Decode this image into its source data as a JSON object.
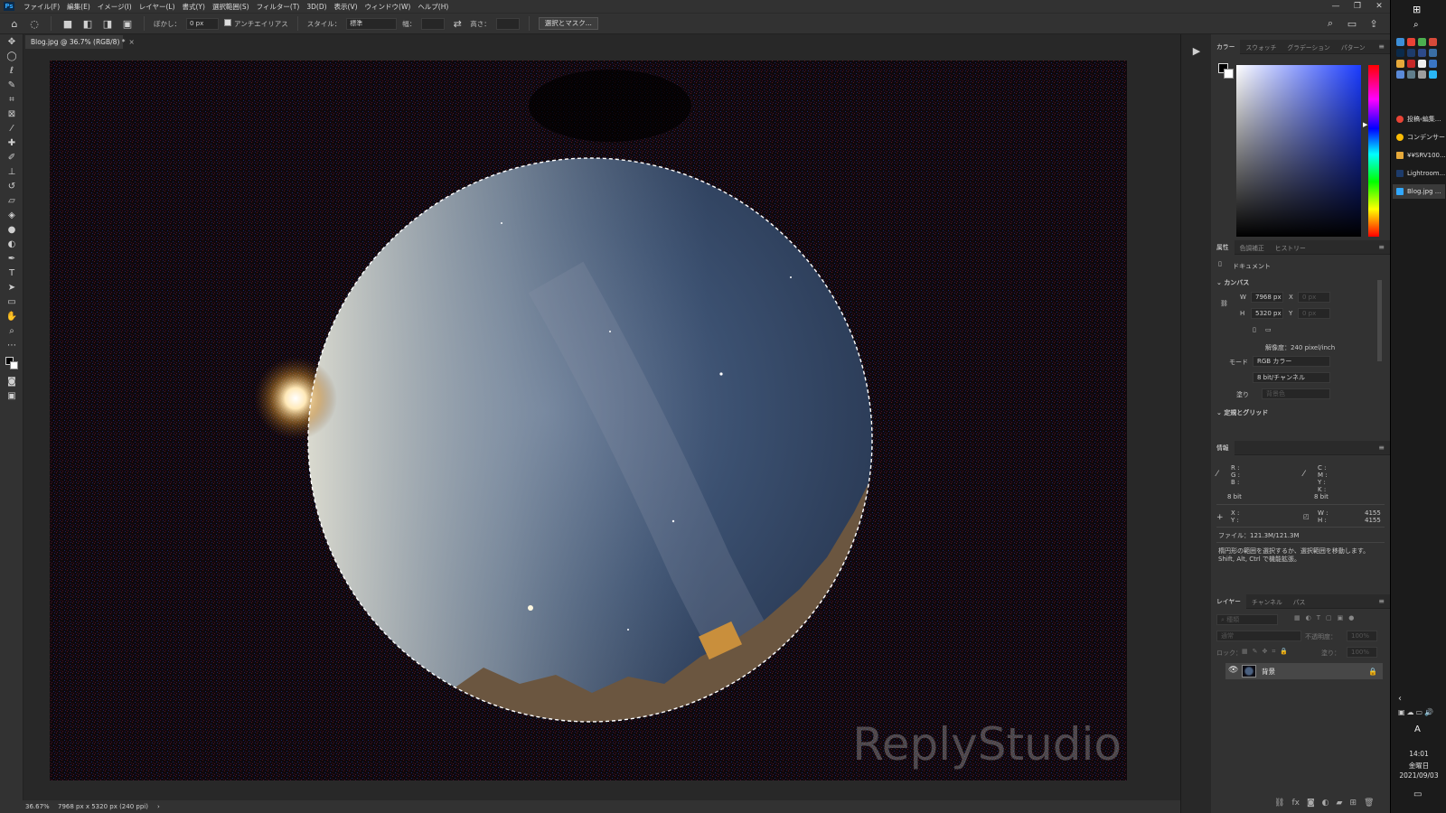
{
  "app": {
    "logo": "Ps"
  },
  "menu": [
    "ファイル(F)",
    "編集(E)",
    "イメージ(I)",
    "レイヤー(L)",
    "書式(Y)",
    "選択範囲(S)",
    "フィルター(T)",
    "3D(D)",
    "表示(V)",
    "ウィンドウ(W)",
    "ヘルプ(H)"
  ],
  "options": {
    "feather_label": "ぼかし：",
    "feather_value": "0 px",
    "antialias_label": "アンチエイリアス",
    "style_label": "スタイル：",
    "style_value": "標準",
    "width_label": "幅：",
    "height_label": "高さ：",
    "select_mask_button": "選択とマスク..."
  },
  "document": {
    "tab_title": "Blog.jpg @ 36.7% (RGB/8) *",
    "watermark": "ReplyStudio"
  },
  "status": {
    "zoom": "36.67%",
    "doc_info": "7968 px x 5320 px (240 ppi)"
  },
  "color_panel": {
    "tabs": [
      "カラー",
      "スウォッチ",
      "グラデーション",
      "パターン"
    ]
  },
  "properties": {
    "tabs": [
      "属性",
      "色調補正",
      "ヒストリー"
    ],
    "doc_label": "ドキュメント",
    "canvas_section": "カンバス",
    "w_label": "W",
    "w_value": "7968 px",
    "h_label": "H",
    "h_value": "5320 px",
    "x_label": "X",
    "x_value": "0 px",
    "y_label": "Y",
    "y_value": "0 px",
    "resolution": "解像度：240 pixel/inch",
    "mode_label": "モード",
    "mode_value": "RGB カラー",
    "bit_value": "8 bit/チャンネル",
    "fill_label": "塗り",
    "fill_value": "背景色",
    "rulers_section": "定規とグリッド"
  },
  "info": {
    "tab": "情報",
    "rgb_labels": "R :\nG :\nB :",
    "cmyk_labels": "C :\nM :\nY :\nK :",
    "bit_left": "8 bit",
    "bit_right": "8 bit",
    "xy_labels": "X :\nY :",
    "wh_labels": "W :\nH :",
    "w_value": "4155",
    "h_value": "4155",
    "file_size": "ファイル：121.3M/121.3M",
    "hint": "楕円形の範囲を選択するか、選択範囲を移動します。Shift, Alt, Ctrl で機能拡張。"
  },
  "layers": {
    "tabs": [
      "レイヤー",
      "チャンネル",
      "パス"
    ],
    "search_placeholder": "種類",
    "blend_mode": "通常",
    "opacity_label": "不透明度：",
    "opacity_value": "100%",
    "lock_label": "ロック：",
    "fill_label": "塗り：",
    "fill_value": "100%",
    "layer_name": "背景"
  },
  "taskbar": {
    "items": [
      "投稿‹編集...",
      "コンデンサー...",
      "¥¥SRV100...",
      "Lightroom...",
      "Blog.jpg ..."
    ],
    "time": "14:01",
    "day": "金曜日",
    "date": "2021/09/03",
    "ime": "A"
  }
}
